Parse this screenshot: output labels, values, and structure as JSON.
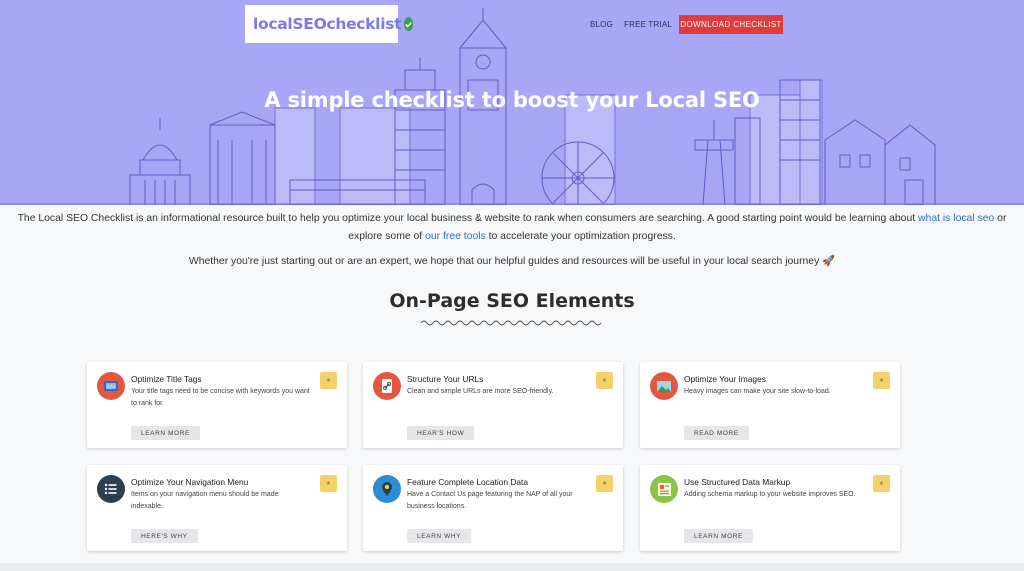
{
  "header": {
    "logo_text": "localSEOchecklist",
    "nav": {
      "blog": "BLOG",
      "free_trial": "FREE TRIAL",
      "cta": "DOWNLOAD CHECKLIST"
    }
  },
  "hero": {
    "title": "A simple checklist to boost your Local SEO"
  },
  "intro": {
    "part1": "The Local SEO Checklist is an informational resource built to help you optimize your local business & website to rank when consumers are searching. A good starting point would be learning about ",
    "link1": "what is local seo",
    "part2": " or explore some of ",
    "link2": "our free tools",
    "part3": " to accelerate your optimization progress.",
    "line2": "Whether you're just starting out or are an expert, we hope that our helpful guides and resources will be useful in your local search journey 🚀"
  },
  "section": {
    "title": "On-Page SEO Elements"
  },
  "cards": [
    {
      "title": "Optimize Title Tags",
      "desc": "Your title tags need to be concise with keywords you want to rank for.",
      "button": "LEARN MORE",
      "icon": "title-tag-icon"
    },
    {
      "title": "Structure Your URLs",
      "desc": "Clean and simple URLs are more SEO-friendly.",
      "button": "HEAR'S HOW",
      "icon": "url-link-icon"
    },
    {
      "title": "Optimize Your Images",
      "desc": "Heavy images can make your site slow-to-load.",
      "button": "READ MORE",
      "icon": "image-icon"
    },
    {
      "title": "Optimize Your Navigation Menu",
      "desc": "Items on your navigation menu should be made indexable.",
      "button": "HERE'S WHY",
      "icon": "menu-list-icon"
    },
    {
      "title": "Feature Complete Location Data",
      "desc": "Have a Contact Us page featuring the NAP of all your business locations.",
      "button": "LEARN WHY",
      "icon": "location-pin-icon"
    },
    {
      "title": "Use Structured Data Markup",
      "desc": "Adding schema markup to your website improves SEO.",
      "button": "LEARN MORE",
      "icon": "schema-code-icon"
    }
  ],
  "colors": {
    "hero_bg": "#a8a6f6",
    "cta": "#e13b3b",
    "link": "#2f6fc2",
    "badge": "#f3d26b"
  }
}
